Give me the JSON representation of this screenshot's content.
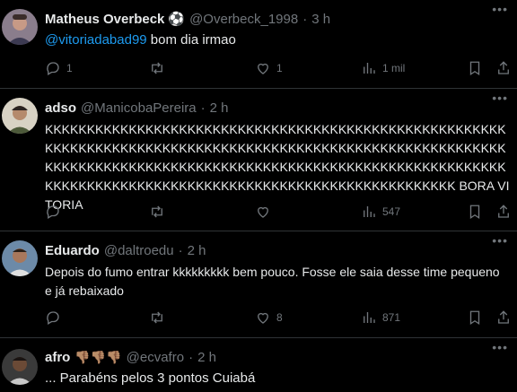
{
  "tweets": [
    {
      "name": "Matheus Overbeck",
      "badge": "⚽",
      "handle": "@Overbeck_1998",
      "time": "3 h",
      "mention": "@vitoriadabad99",
      "text": " bom dia irmao",
      "replies": "1",
      "retweets": "",
      "likes": "1",
      "views": "1 mil"
    },
    {
      "name": "adso",
      "handle": "@ManicobaPereira",
      "time": "2 h",
      "text": "KKKKKKKKKKKKKKKKKKKKKKKKKKKKKKKKKKKKKKKKKKKKKKKKKKKKKKKKKKKKKKKKKKKKKKKKKKKKKKKKKKKKKKKKKKKKKKKKKKKKKKKKKKKKKKKKKKKKKKKKKKKKKKKKKKKKKKKKKKKKKKKKKKKKKKKKKKKKKKKKKKKKKKKKKKKKKKKKKKKKKKKKKKKKKKKKKKKKKKKKKKKKKKKKKKKKKK BORA VITORIA",
      "replies": "",
      "retweets": "",
      "likes": "",
      "views": "547"
    },
    {
      "name": "Eduardo",
      "handle": "@daltroedu",
      "time": "2 h",
      "text": "Depois do fumo entrar kkkkkkkkk bem pouco. Fosse ele saia desse time pequeno e já rebaixado",
      "replies": "",
      "retweets": "",
      "likes": "8",
      "views": "871"
    },
    {
      "name": "afro",
      "badge": "👎🏽👎🏽👎🏽",
      "handle": "@ecvafro",
      "time": "2 h",
      "text": "... Parabéns pelos 3 pontos Cuiabá"
    }
  ],
  "separator": "·",
  "more_glyph": "•••",
  "colors": {
    "background": "#000000",
    "text": "#e7e9ea",
    "muted": "#71767b",
    "link": "#1d9bf0",
    "divider": "#2f3336"
  }
}
